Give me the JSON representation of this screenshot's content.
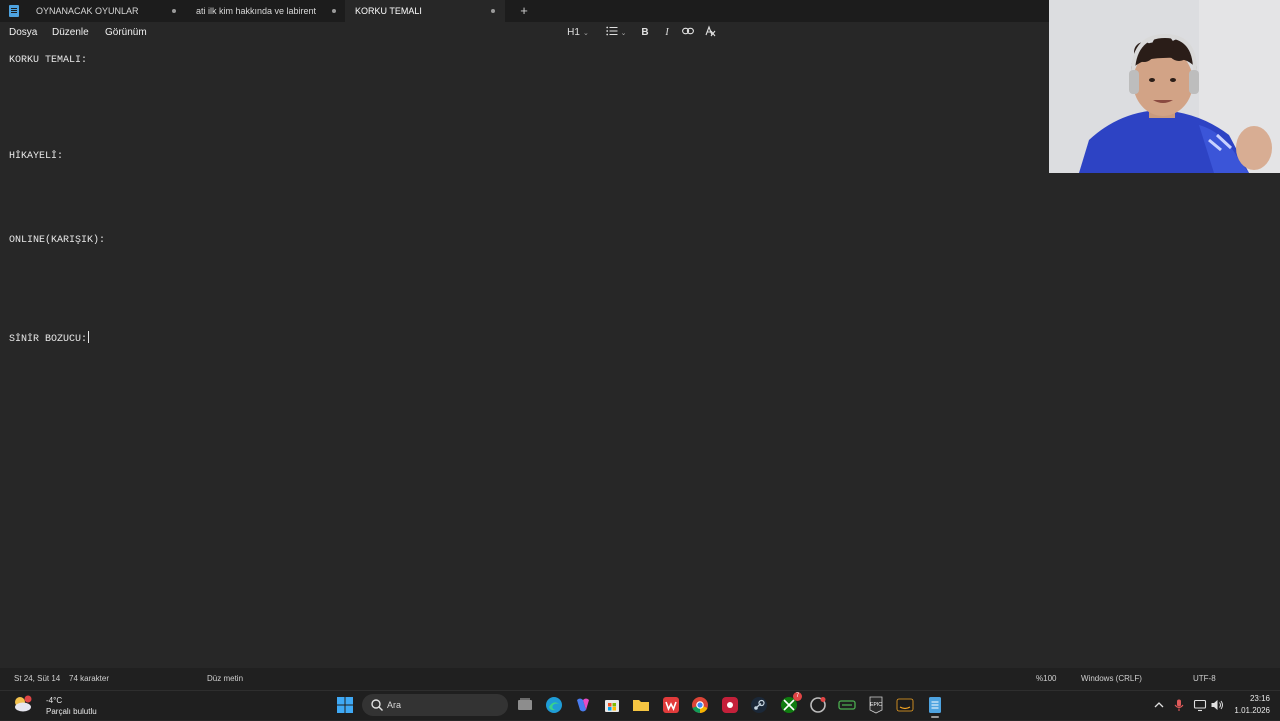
{
  "tabs": [
    {
      "label": "OYNANACAK OYUNLAR",
      "active": false,
      "unsaved": true
    },
    {
      "label": "ati ilk kim hakkında ve labirent",
      "active": false,
      "unsaved": true
    },
    {
      "label": "KORKU TEMALI",
      "active": true,
      "unsaved": true
    }
  ],
  "new_tab_icon": "plus-icon",
  "menu": {
    "file": "Dosya",
    "edit": "Düzenle",
    "view": "Görünüm"
  },
  "format_toolbar": {
    "heading": "H1",
    "list_icon": "bullet-list-icon",
    "bold": "B",
    "italic": "I",
    "link_icon": "link-icon",
    "clear_format_icon": "clear-formatting-icon"
  },
  "document": {
    "lines": [
      "KORKU TEMALI:",
      "HİKAYELİ:",
      "ONLINE(KARIŞIK):",
      "SİNİR BOZUCU:"
    ]
  },
  "statusbar": {
    "position": "St 24, Süt 14",
    "chars": "74 karakter",
    "format": "Düz metin",
    "zoom": "%100",
    "line_endings": "Windows (CRLF)",
    "encoding": "UTF-8"
  },
  "taskbar": {
    "weather_temp": "-4°C",
    "weather_desc": "Parçalı bulutlu",
    "search_placeholder": "Ara",
    "xbox_badge": "7",
    "clock_time": "23:16",
    "clock_date": "1.01.2026"
  },
  "colors": {
    "background": "#272727",
    "titlebar": "#1c1c1c",
    "statusbar": "#202020",
    "accent": "#4ea3e0"
  }
}
